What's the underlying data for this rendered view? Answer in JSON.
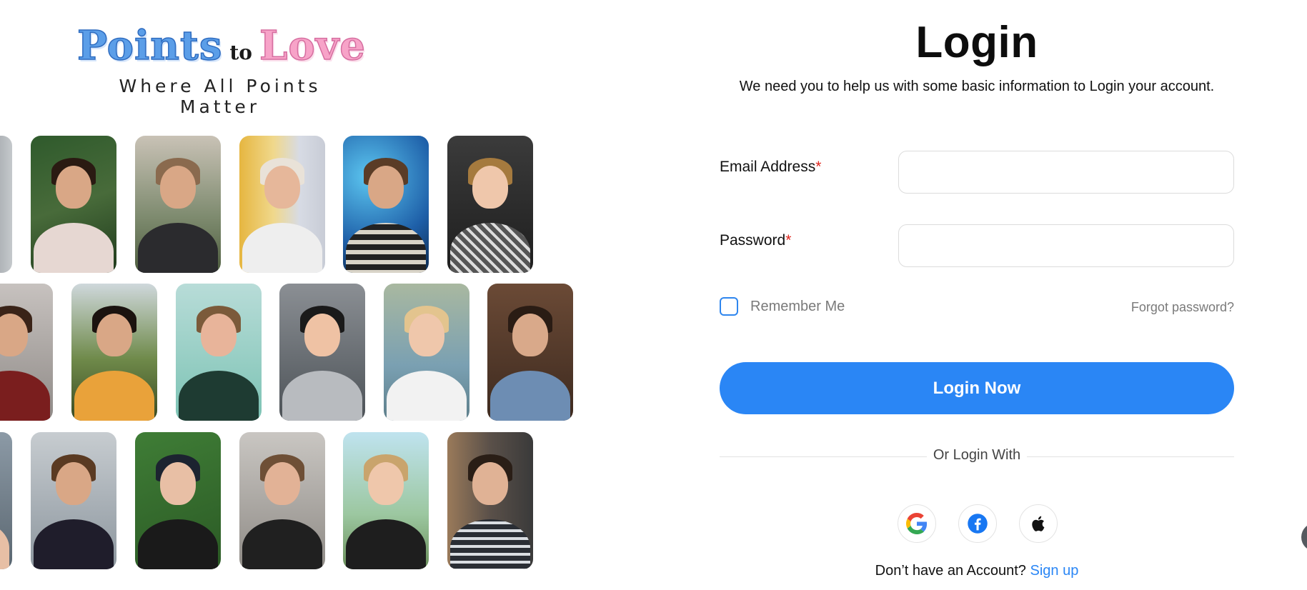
{
  "brand": {
    "logo_word1": "Points",
    "logo_word2": "to",
    "logo_word3": "Love",
    "tagline": "Where All Points Matter"
  },
  "login": {
    "title": "Login",
    "subtitle": "We need you to help us with some basic information to Login your account.",
    "email_label": "Email Address",
    "email_value": "",
    "password_label": "Password",
    "password_value": "",
    "required_mark": "*",
    "remember_label": "Remember Me",
    "remember_checked": false,
    "forgot_label": "Forgot password?",
    "submit_label": "Login Now",
    "divider_label": "Or Login With",
    "social_buttons": [
      "google-icon",
      "facebook-icon",
      "apple-icon"
    ],
    "no_account_text": "Don’t have an Account?",
    "signup_label": "Sign up"
  },
  "colors": {
    "primary": "#2a86f5",
    "required": "#e0241b",
    "muted_text": "#7a7a7a",
    "logo_blue": "#5b9ee8",
    "logo_pink": "#f7a3c8"
  },
  "gallery": {
    "rows": [
      [
        "portrait-1",
        "portrait-2",
        "portrait-3",
        "portrait-4",
        "portrait-5",
        "portrait-6"
      ],
      [
        "portrait-7",
        "portrait-8",
        "portrait-9",
        "portrait-10",
        "portrait-11",
        "portrait-12"
      ],
      [
        "portrait-13",
        "portrait-14",
        "portrait-15",
        "portrait-16",
        "portrait-17",
        "portrait-18"
      ]
    ]
  }
}
